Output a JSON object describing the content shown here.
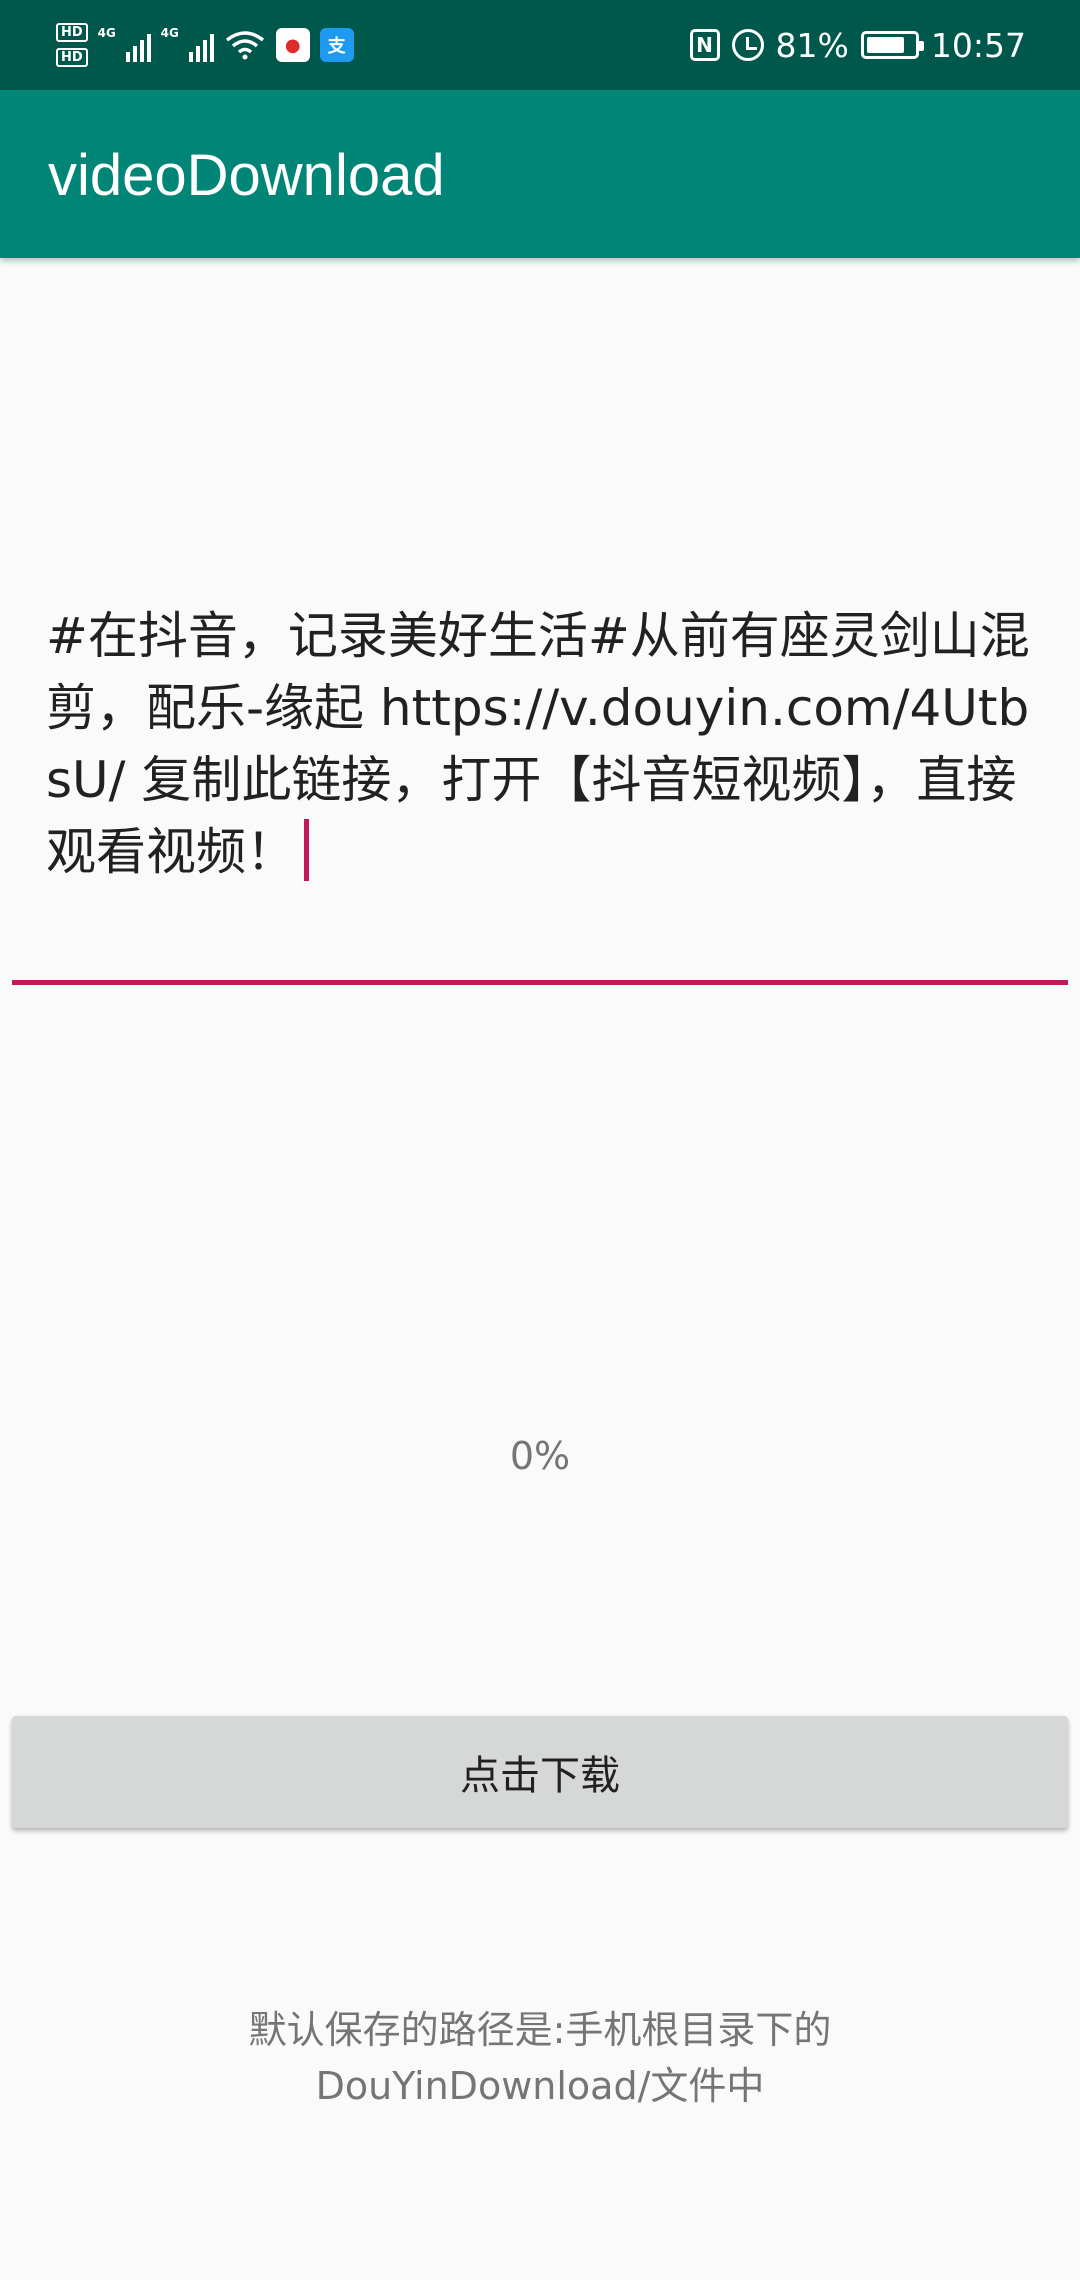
{
  "status_bar": {
    "hd1": "HD",
    "hd2": "HD",
    "net1": "4G",
    "net2": "4G",
    "icons": [
      "hd-icon",
      "signal-icon",
      "signal-icon",
      "wifi-icon",
      "app-notification-icon",
      "alipay-icon",
      "nfc-icon",
      "alarm-icon",
      "battery-icon"
    ],
    "battery_percent": "81%",
    "battery_level": 0.81,
    "time": "10:57"
  },
  "app_bar": {
    "title": "videoDownload"
  },
  "edit": {
    "text": "#在抖音，记录美好生活#从前有座灵剑山混剪，配乐-缘起 https://v.douyin.com/4UtbsU/ 复制此链接，打开【抖音短视频】，直接观看视频！",
    "accent_color": "#c2185b"
  },
  "progress": {
    "label": "0%"
  },
  "actions": {
    "download_label": "点击下载"
  },
  "hint": {
    "line1": "默认保存的路径是:手机根目录下的",
    "line2": "DouYinDownload/文件中"
  },
  "colors": {
    "status_bar": "#00574b",
    "app_bar": "#008577",
    "background": "#fafafa",
    "button": "#d6d7d7"
  }
}
